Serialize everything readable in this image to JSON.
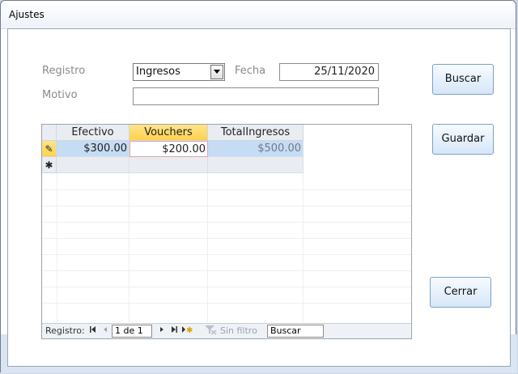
{
  "window": {
    "title": "Ajustes"
  },
  "form": {
    "registro_label": "Registro",
    "registro_value": "Ingresos",
    "fecha_label": "Fecha",
    "fecha_value": "25/11/2020",
    "motivo_label": "Motivo",
    "motivo_value": ""
  },
  "buttons": {
    "buscar": "Buscar",
    "guardar": "Guardar",
    "cerrar": "Cerrar"
  },
  "grid": {
    "columns": [
      "Efectivo",
      "Vouchers",
      "TotalIngresos"
    ],
    "active_column": "Vouchers",
    "rows": [
      {
        "efectivo": "$300.00",
        "vouchers": "$200.00",
        "total": "$500.00"
      }
    ],
    "editing_glyph": "✎",
    "new_row_glyph": "✱"
  },
  "navbar": {
    "registro_label": "Registro:",
    "first_icon": "first-record-icon",
    "prev_icon": "previous-record-icon",
    "position": "1 de 1",
    "next_icon": "next-record-icon",
    "last_icon": "last-record-icon",
    "new_icon": "new-record-icon",
    "filter_label": "Sin filtro",
    "search_value": "Buscar"
  },
  "colors": {
    "active_header": "#ffd24d",
    "selected_cell": "#c6dcf5",
    "button_border": "#7ba1c7"
  }
}
